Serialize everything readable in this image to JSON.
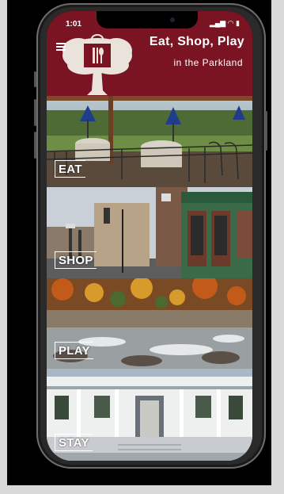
{
  "status_bar": {
    "time": "1:01",
    "icons": "▂▄▆ ◠ ▮"
  },
  "header": {
    "title": "Eat, Shop, Play",
    "subtitle": "in the Parkland",
    "background_color": "#7a1422",
    "menu_icon": "hamburger-menu-icon",
    "logo_icon": "tree-shopping-bag-logo"
  },
  "tiles": [
    {
      "label": "EAT",
      "icon": "outdoor-dining-photo"
    },
    {
      "label": "SHOP",
      "icon": "storefront-street-photo"
    },
    {
      "label": "PLAY",
      "icon": "autumn-river-photo"
    },
    {
      "label": "STAY",
      "icon": "victorian-house-photo"
    }
  ]
}
